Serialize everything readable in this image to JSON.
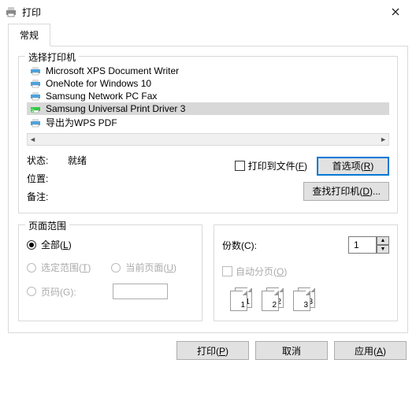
{
  "window": {
    "title": "打印"
  },
  "tabs": {
    "general": "常规"
  },
  "select_printer": {
    "title": "选择打印机",
    "items": [
      {
        "label": "Microsoft XPS Document Writer",
        "selected": false,
        "icon_color": "#4aa3df"
      },
      {
        "label": "OneNote for Windows 10",
        "selected": false,
        "icon_color": "#4aa3df"
      },
      {
        "label": "Samsung Network PC Fax",
        "selected": false,
        "icon_color": "#4aa3df"
      },
      {
        "label": "Samsung Universal Print Driver 3",
        "selected": true,
        "icon_color": "#2ecc40"
      },
      {
        "label": "导出为WPS PDF",
        "selected": false,
        "icon_color": "#4aa3df"
      }
    ]
  },
  "status": {
    "state_label": "状态:",
    "state_value": "就绪",
    "location_label": "位置:",
    "location_value": "",
    "comment_label": "备注:",
    "comment_value": ""
  },
  "print_to_file": {
    "label": "打印到文件(F)",
    "checked": false
  },
  "prefs_btn": "首选项(R)",
  "find_printer_btn": "查找打印机(D)...",
  "page_range": {
    "title": "页面范围",
    "all": "全部(L)",
    "selection": "选定范围(T)",
    "current_page": "当前页面(U)",
    "pages": "页码(G):"
  },
  "copies": {
    "label": "份数(C):",
    "value": "1",
    "collate": "自动分页(O)"
  },
  "footer": {
    "print": "打印(P)",
    "cancel": "取消",
    "apply": "应用(A)"
  }
}
